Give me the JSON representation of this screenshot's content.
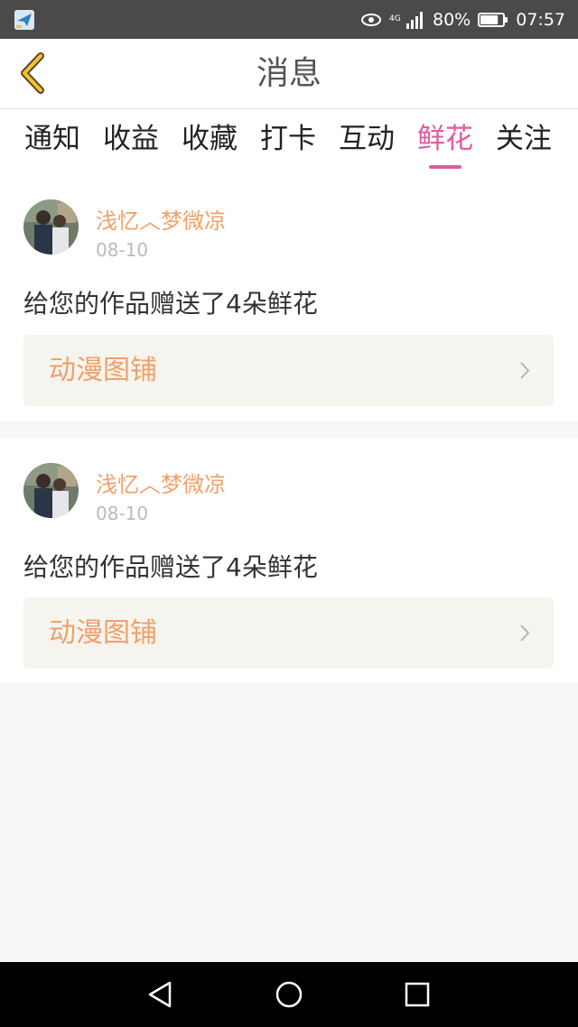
{
  "status_bar": {
    "network": "4G",
    "battery": "80%",
    "battery_level": 0.8,
    "time": "07:57",
    "icons": [
      "app-notification-icon",
      "eye-icon",
      "signal-icon",
      "battery-icon"
    ]
  },
  "header": {
    "title": "消息",
    "back_icon": "chevron-left-icon"
  },
  "tabs": [
    {
      "label": "通知",
      "active": false
    },
    {
      "label": "收益",
      "active": false
    },
    {
      "label": "收藏",
      "active": false
    },
    {
      "label": "打卡",
      "active": false
    },
    {
      "label": "互动",
      "active": false
    },
    {
      "label": "鲜花",
      "active": true
    },
    {
      "label": "关注",
      "active": false
    }
  ],
  "messages": [
    {
      "user": "浅忆︿梦微凉",
      "date": "08-10",
      "text": "给您的作品赠送了4朵鲜花",
      "work": "动漫图铺"
    },
    {
      "user": "浅忆︿梦微凉",
      "date": "08-10",
      "text": "给您的作品赠送了4朵鲜花",
      "work": "动漫图铺"
    }
  ],
  "colors": {
    "accent": "#e25a9e",
    "username": "#f0a06a",
    "back_icon": "#e8b52a"
  },
  "nav_bar": {
    "icons": [
      "back-triangle-icon",
      "home-circle-icon",
      "recents-square-icon"
    ]
  }
}
